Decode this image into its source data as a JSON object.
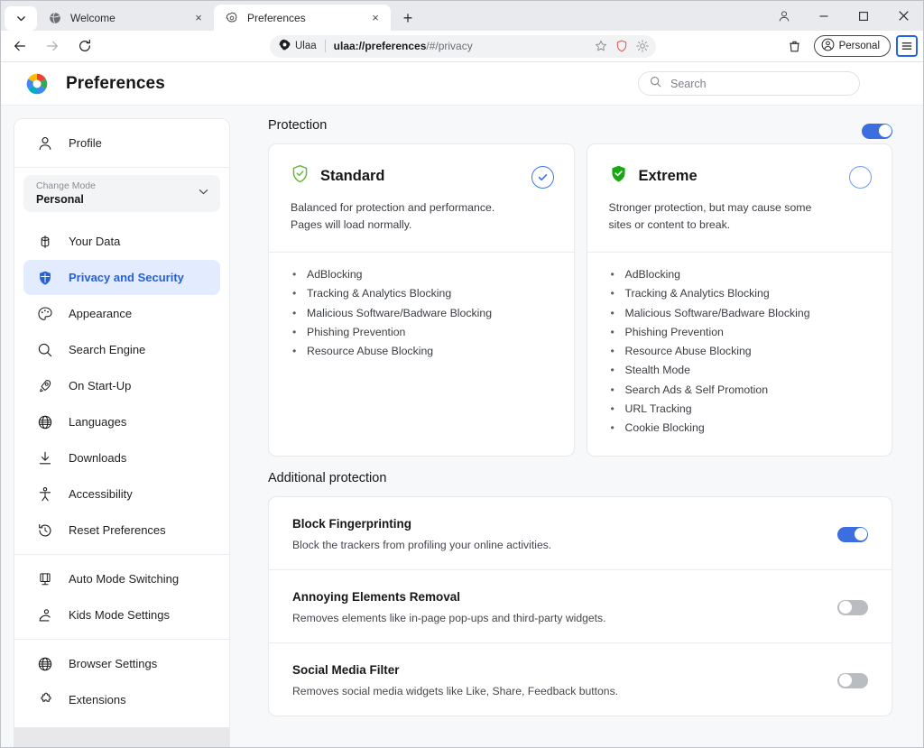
{
  "browser": {
    "tabs": [
      {
        "title": "Welcome",
        "icon": "globe-icon",
        "active": false
      },
      {
        "title": "Preferences",
        "icon": "gear-icon",
        "active": true
      }
    ],
    "new_tab_label": "+",
    "tab_close_label": "×",
    "tab_list_chevron": "⌄",
    "window_controls": {
      "minimize": "–",
      "maximize": "□",
      "close": "✕",
      "account": "account-icon"
    },
    "nav": {
      "back": "←",
      "forward": "→",
      "reload": "↻"
    },
    "omnibox": {
      "brand": "Ulaa",
      "url_bold": "ulaa://preferences",
      "url_rest": "/#/privacy",
      "icons": [
        "bookmark-star-icon",
        "shield-icon",
        "brightness-icon"
      ]
    },
    "toolbar_right": {
      "trash_icon": "trash-icon",
      "profile_label": "Personal",
      "menu_icon": "hamburger-menu-icon"
    }
  },
  "page": {
    "title": "Preferences",
    "search": {
      "placeholder": "Search",
      "value": ""
    }
  },
  "sidebar": {
    "profile": {
      "label": "Profile",
      "icon": "person-icon"
    },
    "mode": {
      "label": "Change Mode",
      "value": "Personal",
      "chevron": "chevron-down-icon"
    },
    "groups": [
      {
        "items": [
          {
            "label": "Your Data",
            "icon": "database-icon",
            "active": false
          },
          {
            "label": "Privacy and Security",
            "icon": "shield-icon",
            "active": true
          },
          {
            "label": "Appearance",
            "icon": "palette-icon",
            "active": false
          },
          {
            "label": "Search Engine",
            "icon": "search-icon",
            "active": false
          },
          {
            "label": "On Start-Up",
            "icon": "rocket-icon",
            "active": false
          },
          {
            "label": "Languages",
            "icon": "globe-icon",
            "active": false
          },
          {
            "label": "Downloads",
            "icon": "download-icon",
            "active": false
          },
          {
            "label": "Accessibility",
            "icon": "accessibility-icon",
            "active": false
          },
          {
            "label": "Reset Preferences",
            "icon": "history-icon",
            "active": false
          }
        ]
      },
      {
        "items": [
          {
            "label": "Auto Mode Switching",
            "icon": "monitor-icon",
            "active": false
          },
          {
            "label": "Kids Mode Settings",
            "icon": "kids-icon",
            "active": false
          }
        ]
      },
      {
        "items": [
          {
            "label": "Browser Settings",
            "icon": "globe-icon",
            "active": false
          },
          {
            "label": "Extensions",
            "icon": "puzzle-icon",
            "active": false
          }
        ]
      }
    ]
  },
  "protection": {
    "heading": "Protection",
    "master_toggle": {
      "state": "on",
      "name": "protection-master-toggle"
    },
    "cards": [
      {
        "name": "Standard",
        "icon": "shield-check-outline-icon",
        "icon_color": "#5fb832",
        "description": "Balanced for protection and performance. Pages will load normally.",
        "selected": true,
        "features": [
          "AdBlocking",
          "Tracking & Analytics Blocking",
          "Malicious Software/Badware Blocking",
          "Phishing Prevention",
          "Resource Abuse Blocking"
        ]
      },
      {
        "name": "Extreme",
        "icon": "shield-check-filled-icon",
        "icon_color": "#17a814",
        "description": "Stronger protection, but may cause some sites or content to break.",
        "selected": false,
        "features": [
          "AdBlocking",
          "Tracking & Analytics Blocking",
          "Malicious Software/Badware Blocking",
          "Phishing Prevention",
          "Resource Abuse Blocking",
          "Stealth Mode",
          "Search Ads & Self Promotion",
          "URL Tracking",
          "Cookie Blocking"
        ]
      }
    ]
  },
  "additional_protection": {
    "heading": "Additional protection",
    "rows": [
      {
        "title": "Block Fingerprinting",
        "subtitle": "Block the trackers from profiling your online activities.",
        "state": "on"
      },
      {
        "title": "Annoying Elements Removal",
        "subtitle": "Removes elements like in-page pop-ups and third-party widgets.",
        "state": "off"
      },
      {
        "title": "Social Media Filter",
        "subtitle": "Removes social media widgets like Like, Share, Feedback buttons.",
        "state": "off"
      }
    ]
  },
  "colors": {
    "accent_blue": "#3b6fe0",
    "active_item_bg": "#e3ecfe",
    "active_item_text": "#2461d8",
    "standard_green": "#5fb832",
    "extreme_green": "#17a814"
  }
}
